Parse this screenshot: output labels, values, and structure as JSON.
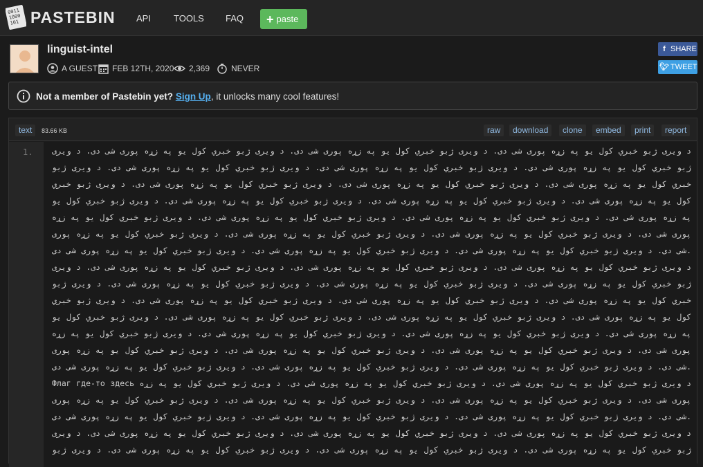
{
  "header": {
    "logo_text": "PASTEBIN",
    "nav": [
      "API",
      "TOOLS",
      "FAQ"
    ],
    "paste_button": "paste"
  },
  "paste": {
    "title": "linguist-intel",
    "author": "A GUEST",
    "date": "FEB 12TH, 2020",
    "views": "2,369",
    "expiration": "NEVER"
  },
  "share": {
    "facebook": "SHARE",
    "twitter": "TWEET"
  },
  "notice": {
    "question": "Not a member of Pastebin yet?",
    "signup": "Sign Up",
    "rest": ", it unlocks many cool features!"
  },
  "code": {
    "syntax": "text",
    "size": "83.66 KB",
    "actions": [
      "raw",
      "download",
      "clone",
      "embed",
      "print",
      "report"
    ],
    "line_number": "1.",
    "lines": [
      "د ویری ژبو خبري کول یو په زړه پوری شی دی. د ویری ژبو خبري کول یو په زړه پوری شی دی. د ویری ژبو خبري کول یو په زړه پوری شی دی. د ویری",
      "ژبو خبري کول یو په زړه پوری شی دی. د ویری ژبو خبري کول یو په زړه پوری شی دی. د ویری ژبو خبري کول یو په زړه پوری شی دی. د ویری ژبو",
      "خبري کول یو په زړه پوری شی دی. د ویری ژبو خبري کول یو په زړه پوری شی دی. د ویری ژبو خبري کول یو په زړه پوری شی دی. د ویری ژبو خبري",
      "کول یو په زړه پوری شی دی. د ویری ژبو خبري کول یو په زړه پوری شی دی. د ویری ژبو خبري کول یو په زړه پوری شی دی. د ویری ژبو خبري کول یو",
      "په زړه پوری شی دی. د ویری ژبو خبري کول یو په زړه پوری شی دی. د ویری ژبو خبري کول یو په زړه پوری شی دی. د ویری ژبو خبري کول یو په زړه",
      "پوری شی دی. د ویری ژبو خبري کول یو په زړه پوری شی دی. د ویری ژبو خبري کول یو په زړه پوری شی دی. د ویری ژبو خبري کول یو په زړه پوری",
      "شی دی. د ویری ژبو خبري کول یو په زړه پوری شی دی. د ویری ژبو خبري کول یو په زړه پوری شی دی. د ویری ژبو خبري کول یو په زړه پوری شی دی.",
      "د ویری ژبو خبري کول یو په زړه پوری شی دی. د ویری ژبو خبري کول یو په زړه پوری شی دی. د ویری ژبو خبري کول یو په زړه پوری شی دی. د ویری",
      "ژبو خبري کول یو په زړه پوری شی دی. د ویری ژبو خبري کول یو په زړه پوری شی دی. د ویری ژبو خبري کول یو په زړه پوری شی دی. د ویری ژبو",
      "خبري کول یو په زړه پوری شی دی. د ویری ژبو خبري کول یو په زړه پوری شی دی. د ویری ژبو خبري کول یو په زړه پوری شی دی. د ویری ژبو خبري",
      "کول یو په زړه پوری شی دی. د ویری ژبو خبري کول یو په زړه پوری شی دی. د ویری ژبو خبري کول یو په زړه پوری شی دی. د ویری ژبو خبري کول یو",
      "په زړه پوری شی دی. د ویری ژبو خبري کول یو په زړه پوری شی دی. د ویری ژبو خبري کول یو په زړه پوری شی دی. د ویری ژبو خبري کول یو په زړه",
      "پوری شی دی. د ویری ژبو خبري کول یو په زړه پوری شی دی. د ویری ژبو خبري کول یو په زړه پوری شی دی. د ویری ژبو خبري کول یو په زړه پوری",
      "شی دی. د ویری ژبو خبري کول یو په زړه پوری شی دی. د ویری ژبو خبري کول یو په زړه پوری شی دی. د ویری ژبو خبري کول یو په زړه پوری شی دی.",
      "Флаг где-то здесь  د ویری ژبو خبري کول یو په زړه پوری شی دی. د ویری ژبو خبري کول یو په زړه پوری شی دی. د ویری ژبو خبري کول یو په زړه",
      "پوری شی دی. د ویری ژبو خبري کول یو په زړه پوری شی دی. د ویری ژبو خبري کول یو په زړه پوری شی دی. د ویری ژبو خبري کول یو په زړه پوری",
      "شی دی. د ویری ژبو خبري کول یو په زړه پوری شی دی. د ویری ژبو خبري کول یو په زړه پوری شی دی. د ویری ژبو خبري کول یو په زړه پوری شی دی.",
      "د ویری ژبو خبري کول یو په زړه پوری شی دی. د ویری ژبو خبري کول یو په زړه پوری شی دی. د ویری ژبو خبري کول یو په زړه پوری شی دی. د ویری",
      "ژبو خبري کول یو په زړه پوری شی دی. د ویری ژبو خبري کول یو په زړه پوری شی دی. د ویری ژبو خبري کول یو په زړه پوری شی دی. د ویری ژبو"
    ]
  }
}
